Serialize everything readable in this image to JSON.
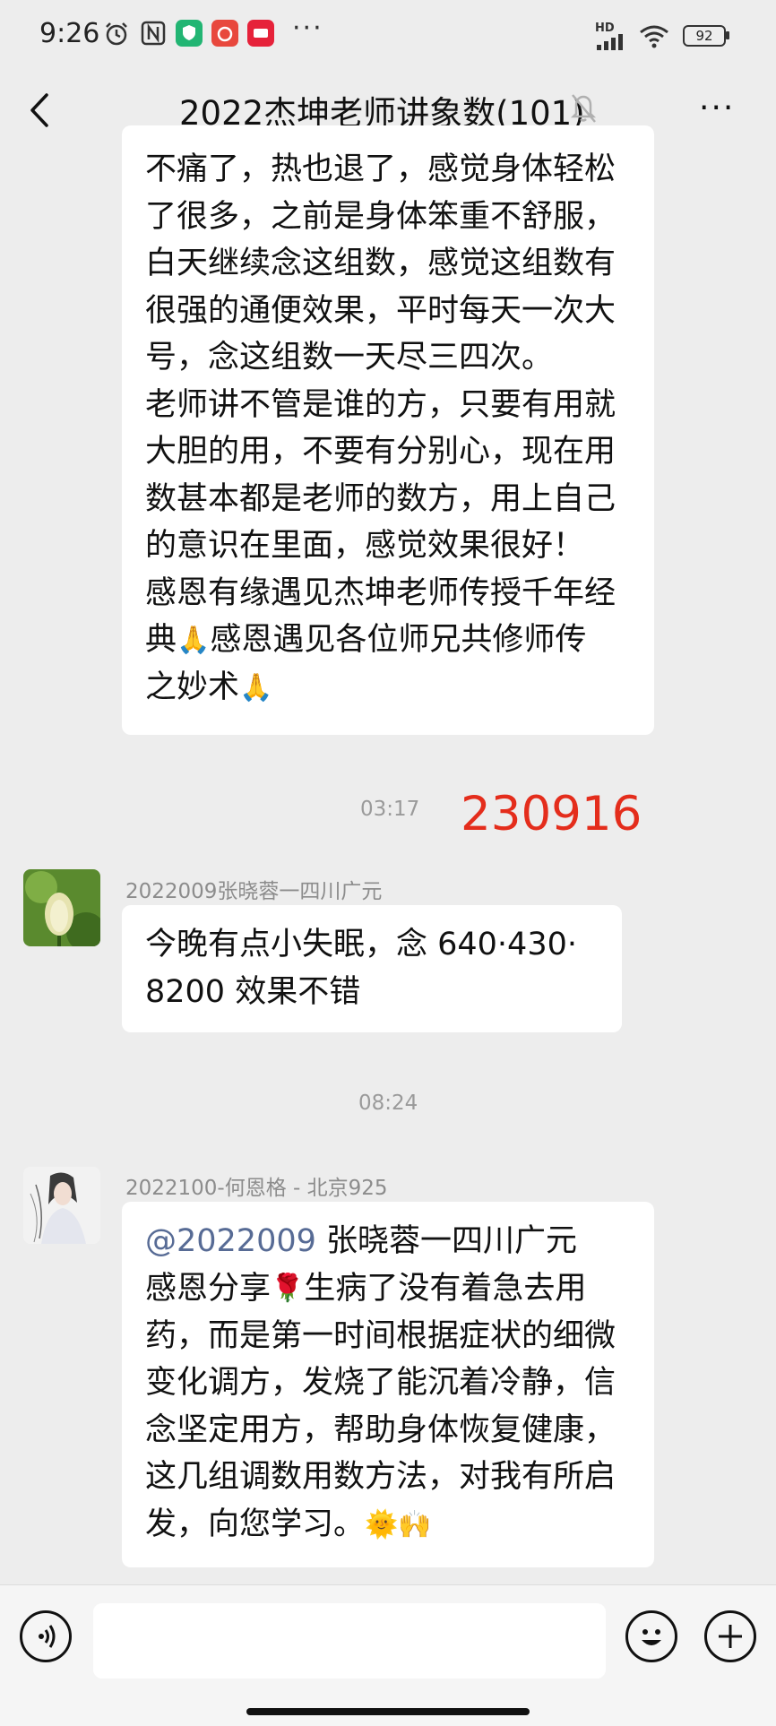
{
  "status_bar": {
    "time": "9:26",
    "network_label": "HD",
    "battery": "92"
  },
  "header": {
    "title": "2022杰坤老师讲象数(101)"
  },
  "messages": {
    "msg1_lines": [
      "不痛了，热也退了，感觉身体轻松",
      "了很多，之前是身体笨重不舒服，",
      "白天继续念这组数，感觉这组数有",
      "很强的通便效果，平时每天一次大",
      "号，念这组数一天尽三四次。",
      "老师讲不管是谁的方，只要有用就",
      "大胆的用，不要有分别心，现在用",
      "数甚本都是老师的数方，用上自己",
      "的意识在里面，感觉效果很好！",
      "感恩有缘遇见杰坤老师传授千年经"
    ],
    "msg1_line11": {
      "pre": "典",
      "post": "感恩遇见各位师兄共修师传"
    },
    "msg1_line12": "之妙术",
    "timestamp1": "03:17",
    "red_code": "230916",
    "sender2": "2022009张晓蓉一四川广元",
    "msg2_lines": [
      "今晚有点小失眠，念 640·430·",
      "8200 效果不错"
    ],
    "timestamp2": "08:24",
    "sender3": "2022100-何恩格 - 北京925",
    "msg3_mention": "@2022009",
    "msg3_line1_rest": " 张晓蓉一四川广元",
    "msg3_line2": {
      "pre": "感恩分享",
      "post": "生病了没有着急去用"
    },
    "msg3_lines": [
      "药，而是第一时间根据症状的细微",
      "变化调方，发烧了能沉着冷静，信",
      "念坚定用方，帮助身体恢复健康，",
      "这几组调数用数方法，对我有所启"
    ],
    "msg3_last": "发，向您学习。"
  },
  "icons": {
    "pray": "🙏",
    "rose": "🌹",
    "sun": "🌞",
    "clap": "🙌"
  },
  "colors": {
    "chat_bg": "#ededed",
    "bubble_bg": "#ffffff",
    "red_code": "#e42d1c",
    "mention": "#576b95"
  }
}
